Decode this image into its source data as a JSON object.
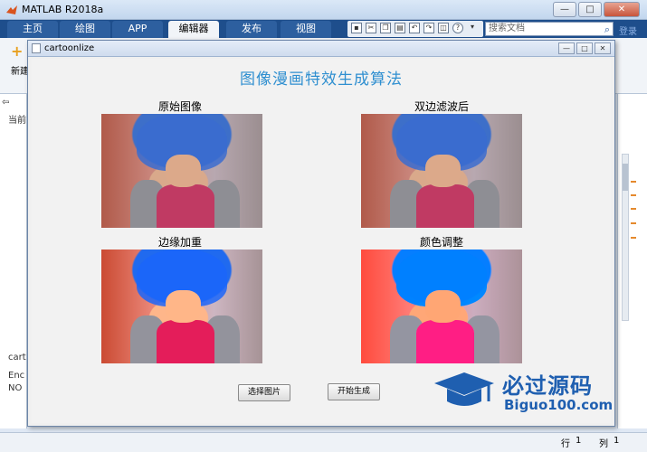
{
  "app": {
    "title": "MATLAB R2018a"
  },
  "window_controls": {
    "minimize": "—",
    "maximize": "□",
    "close": "✕"
  },
  "ribbon": {
    "tabs": [
      "主页",
      "绘图",
      "APP",
      "编辑器",
      "发布",
      "视图"
    ],
    "active_tab": "编辑器",
    "new_label": "新建",
    "search_placeholder": "搜索文档",
    "login": "登录",
    "qa_help": "?"
  },
  "side_text": {
    "left_current": "当前",
    "left_cart": "cart",
    "left_enc": "Enc",
    "left_no": "NO"
  },
  "status": {
    "row_label": "行",
    "row_value": "1",
    "col_label": "列",
    "col_value": "1"
  },
  "figure": {
    "window_title": "cartoonlize",
    "main_title": "图像漫画特效生成算法",
    "panels": {
      "original": "原始图像",
      "bilateral": "双边滤波后",
      "edge": "边缘加重",
      "color": "颜色调整"
    },
    "buttons": {
      "select": "选择图片",
      "start": "开始生成"
    }
  },
  "watermark": {
    "title": "必过源码",
    "url": "Biguo100.com"
  },
  "colors": {
    "title_blue": "#2f8fd0",
    "ribbon_blue": "#1e4e8c",
    "watermark_blue": "#1f5fb0"
  }
}
